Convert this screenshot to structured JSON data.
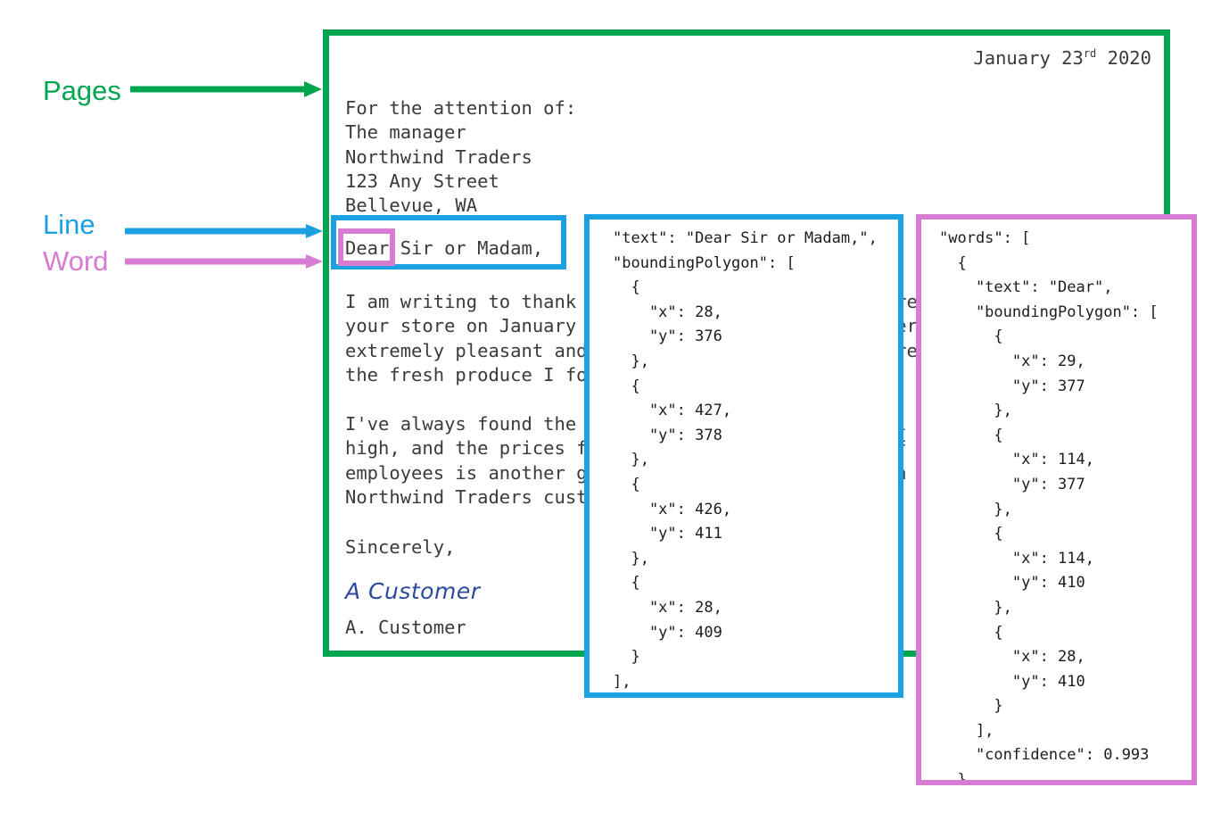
{
  "legend": {
    "pages": "Pages",
    "line": "Line",
    "word": "Word"
  },
  "colors": {
    "page_green": "#00A550",
    "line_blue": "#1BA1E2",
    "word_pink": "#D87BD2",
    "signature_blue": "#2B4A9B",
    "body_text": "#3A3A3A"
  },
  "letter": {
    "date_month_day": "January 23",
    "date_ordinal": "rd",
    "date_year": " 2020",
    "address_block": "For the attention of:\nThe manager\nNorthwind Traders\n123 Any Street\nBellevue, WA",
    "salutation_word": "Dear",
    "salutation_rest": " Sir or Madam,",
    "body_paragraph_1": "I am writing to thank you for the great service I received at\nyour store on January 20th. The staff at the counter were\nextremely pleasant and helpful, and I was very impressed with\nthe fresh produce I found on the shelves.",
    "body_paragraph_2": "I've always found the quality of the goods you sell to be very\nhigh, and the prices fair. The friendly attitude of your\nemployees is another great reason why I will remain a loyal\nNorthwind Traders customer for many years to come.",
    "sign_off": "Sincerely,",
    "signature": "A Customer",
    "printed_name": "A. Customer"
  },
  "line_json": {
    "label": "line-level OCR result",
    "text": "\"text\": \"Dear Sir or Madam,\",\n\"boundingPolygon\": [\n  {\n    \"x\": 28,\n    \"y\": 376\n  },\n  {\n    \"x\": 427,\n    \"y\": 378\n  },\n  {\n    \"x\": 426,\n    \"y\": 411\n  },\n  {\n    \"x\": 28,\n    \"y\": 409\n  }\n],"
  },
  "word_json": {
    "label": "word-level OCR result",
    "text": "\"words\": [\n  {\n    \"text\": \"Dear\",\n    \"boundingPolygon\": [\n      {\n        \"x\": 29,\n        \"y\": 377\n      },\n      {\n        \"x\": 114,\n        \"y\": 377\n      },\n      {\n        \"x\": 114,\n        \"y\": 410\n      },\n      {\n        \"x\": 28,\n        \"y\": 410\n      }\n    ],\n    \"confidence\": 0.993\n  },"
  }
}
